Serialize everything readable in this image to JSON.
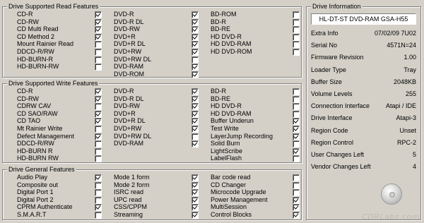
{
  "read_features": {
    "title": "Drive Supported Read Features",
    "columns": [
      [
        {
          "label": "CD-R",
          "checked": true
        },
        {
          "label": "CD-RW",
          "checked": true
        },
        {
          "label": "CD Multi Read",
          "checked": true
        },
        {
          "label": "CD Method 2",
          "checked": true
        },
        {
          "label": "Mount Rainier Read",
          "checked": false
        },
        {
          "label": "DDCD-R/RW",
          "checked": false
        },
        {
          "label": "HD-BURN-R",
          "checked": false
        },
        {
          "label": "HD-BURN-RW",
          "checked": false
        }
      ],
      [
        {
          "label": "DVD-R",
          "checked": true
        },
        {
          "label": "DVD-R DL",
          "checked": true
        },
        {
          "label": "DVD-RW",
          "checked": true
        },
        {
          "label": "DVD+R",
          "checked": true
        },
        {
          "label": "DVD+R DL",
          "checked": true
        },
        {
          "label": "DVD+RW",
          "checked": true
        },
        {
          "label": "DVD+RW DL",
          "checked": false
        },
        {
          "label": "DVD-RAM",
          "checked": true
        },
        {
          "label": "DVD-ROM",
          "checked": true
        }
      ],
      [
        {
          "label": "BD-ROM",
          "checked": false
        },
        {
          "label": "BD-R",
          "checked": false
        },
        {
          "label": "BD-RE",
          "checked": false
        },
        {
          "label": "HD DVD-R",
          "checked": false
        },
        {
          "label": "HD DVD-RAM",
          "checked": false
        },
        {
          "label": "HD DVD-ROM",
          "checked": false
        }
      ]
    ]
  },
  "write_features": {
    "title": "Drive Supported Write Features",
    "columns": [
      [
        {
          "label": "CD-R",
          "checked": true
        },
        {
          "label": "CD-RW",
          "checked": true
        },
        {
          "label": "CDRW CAV",
          "checked": false
        },
        {
          "label": "CD SAO/RAW",
          "checked": true
        },
        {
          "label": "CD TAO",
          "checked": true
        },
        {
          "label": "Mt Rainier Write",
          "checked": false
        },
        {
          "label": "Defect Management",
          "checked": true
        },
        {
          "label": "DDCD-R/RW",
          "checked": false
        },
        {
          "label": "HD-BURN R",
          "checked": false
        },
        {
          "label": "HD-BURN RW",
          "checked": false
        }
      ],
      [
        {
          "label": "DVD-R",
          "checked": true
        },
        {
          "label": "DVD-R DL",
          "checked": true
        },
        {
          "label": "DVD-RW",
          "checked": true
        },
        {
          "label": "DVD+R",
          "checked": true
        },
        {
          "label": "DVD+R DL",
          "checked": true
        },
        {
          "label": "DVD+RW",
          "checked": true
        },
        {
          "label": "DVD+RW DL",
          "checked": false
        },
        {
          "label": "DVD-RAM",
          "checked": true
        }
      ],
      [
        {
          "label": "BD-R",
          "checked": false
        },
        {
          "label": "BD-RE",
          "checked": false
        },
        {
          "label": "HD DVD-R",
          "checked": false
        },
        {
          "label": "HD DVD-RAM",
          "checked": false
        },
        {
          "label": "Buffer Underun",
          "checked": true
        },
        {
          "label": "Test Write",
          "checked": true
        },
        {
          "label": "LayerJump Recording",
          "checked": true
        },
        {
          "label": "Solid Burn",
          "checked": false
        },
        {
          "label": "LightScribe",
          "checked": true
        },
        {
          "label": "LabelFlash",
          "checked": false
        }
      ]
    ]
  },
  "general_features": {
    "title": "Drive General Features",
    "columns": [
      [
        {
          "label": "Audio Play",
          "checked": true
        },
        {
          "label": "Composite out",
          "checked": false
        },
        {
          "label": "Digital Port 1",
          "checked": false
        },
        {
          "label": "Digital Port 2",
          "checked": false
        },
        {
          "label": "CPRM Authenticate",
          "checked": true
        },
        {
          "label": "S.M.A.R.T",
          "checked": false
        }
      ],
      [
        {
          "label": "Mode 1 form",
          "checked": true
        },
        {
          "label": "Mode 2 form",
          "checked": true
        },
        {
          "label": "ISRC read",
          "checked": true
        },
        {
          "label": "UPC read",
          "checked": true
        },
        {
          "label": "CSS/CPPM",
          "checked": true
        },
        {
          "label": "Streaming",
          "checked": true
        }
      ],
      [
        {
          "label": "Bar code read",
          "checked": false
        },
        {
          "label": "CD Changer",
          "checked": false
        },
        {
          "label": "Microcode Upgrade",
          "checked": false
        },
        {
          "label": "Power Management",
          "checked": true
        },
        {
          "label": "MultiSession",
          "checked": true
        },
        {
          "label": "Control Blocks",
          "checked": true
        }
      ]
    ]
  },
  "drive_info": {
    "title": "Drive Information",
    "drive_name": "HL-DT-ST DVD-RAM GSA-H55",
    "rows": [
      {
        "key": "Extra Info",
        "value": "07/02/09 7U02"
      },
      {
        "key": "Serial No",
        "value": "4571N=24"
      },
      {
        "key": "Firmware Revision",
        "value": "1.00"
      },
      {
        "key": "Loader Type",
        "value": "Tray"
      },
      {
        "key": "Buffer Size",
        "value": "2048KB"
      },
      {
        "key": "Volume Levels",
        "value": "255"
      },
      {
        "key": "Connection Interface",
        "value": "Atapi / IDE"
      },
      {
        "key": "Drive Interface",
        "value": "Atapi-3"
      },
      {
        "key": "Region Code",
        "value": "Unset"
      },
      {
        "key": "Region Control",
        "value": "RPC-2"
      },
      {
        "key": "User Changes Left",
        "value": "5"
      },
      {
        "key": "Vendor Changes Left",
        "value": "4"
      }
    ],
    "watermark": "CDRLabs.com",
    "disc_icon": "disc-icon"
  }
}
